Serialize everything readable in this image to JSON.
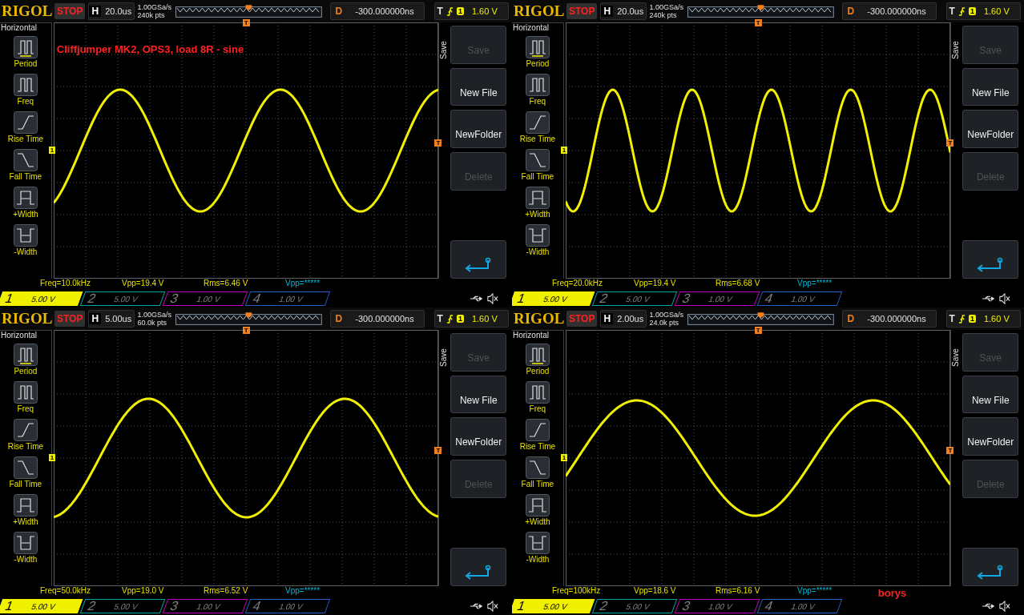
{
  "panels": [
    {
      "logo": "RIGOL",
      "status": "STOP",
      "h_label": "H",
      "timebase": "20.0us",
      "sample_rate": "1.00GSa/s",
      "points": "240k pts",
      "d_label": "D",
      "delay": "-300.000000ns",
      "t_label": "T",
      "trigger_source": "1",
      "trigger_level": "1.60 V",
      "annotation": {
        "text": "Cliffjumper MK2, OPS3, load 8R - sine",
        "kind": "top"
      },
      "trigger_marker": "T",
      "trigger_level_marker": "T",
      "channel_marker": "1",
      "side_title": "Horizontal",
      "sidebar": [
        {
          "label": "Period",
          "kind": "period"
        },
        {
          "label": "Freq",
          "kind": "freq"
        },
        {
          "label": "Rise Time",
          "kind": "rise"
        },
        {
          "label": "Fall Time",
          "kind": "fall"
        },
        {
          "label": "+Width",
          "kind": "pwidth"
        },
        {
          "label": "-Width",
          "kind": "nwidth"
        }
      ],
      "menu_title": "Save",
      "menu": [
        {
          "label": "Save",
          "disabled": true
        },
        {
          "label": "New File",
          "disabled": false
        },
        {
          "label": "NewFolder",
          "disabled": false
        },
        {
          "label": "Delete",
          "disabled": true
        }
      ],
      "measurements": [
        {
          "text": "Freq=10.0kHz",
          "color": "#e8e000"
        },
        {
          "text": "Vpp=19.4 V",
          "color": "#e8e000"
        },
        {
          "text": "Rms=6.46 V",
          "color": "#e8e000"
        },
        {
          "text": "Vpp=*****",
          "color": "#00b8d8"
        }
      ],
      "channels": [
        {
          "number": "1",
          "scale": "5.00 V",
          "selected": true,
          "color": "#f0f000"
        },
        {
          "number": "2",
          "scale": "5.00 V",
          "selected": false,
          "color": "#00a8a0"
        },
        {
          "number": "3",
          "scale": "1.00 V",
          "selected": false,
          "color": "#c000c0"
        },
        {
          "number": "4",
          "scale": "1.00 V",
          "selected": false,
          "color": "#2060c0"
        }
      ]
    },
    {
      "logo": "RIGOL",
      "status": "STOP",
      "h_label": "H",
      "timebase": "20.0us",
      "sample_rate": "1.00GSa/s",
      "points": "240k pts",
      "d_label": "D",
      "delay": "-300.000000ns",
      "t_label": "T",
      "trigger_source": "1",
      "trigger_level": "1.60 V",
      "trigger_marker": "T",
      "trigger_level_marker": "T",
      "channel_marker": "1",
      "side_title": "Horizontal",
      "sidebar": [
        {
          "label": "Period",
          "kind": "period"
        },
        {
          "label": "Freq",
          "kind": "freq"
        },
        {
          "label": "Rise Time",
          "kind": "rise"
        },
        {
          "label": "Fall Time",
          "kind": "fall"
        },
        {
          "label": "+Width",
          "kind": "pwidth"
        },
        {
          "label": "-Width",
          "kind": "nwidth"
        }
      ],
      "menu_title": "Save",
      "menu": [
        {
          "label": "Save",
          "disabled": true
        },
        {
          "label": "New File",
          "disabled": false
        },
        {
          "label": "NewFolder",
          "disabled": false
        },
        {
          "label": "Delete",
          "disabled": true
        }
      ],
      "measurements": [
        {
          "text": "Freq=20.0kHz",
          "color": "#e8e000"
        },
        {
          "text": "Vpp=19.4 V",
          "color": "#e8e000"
        },
        {
          "text": "Rms=6.68 V",
          "color": "#e8e000"
        },
        {
          "text": "Vpp=*****",
          "color": "#00b8d8"
        }
      ],
      "channels": [
        {
          "number": "1",
          "scale": "5.00 V",
          "selected": true,
          "color": "#f0f000"
        },
        {
          "number": "2",
          "scale": "5.00 V",
          "selected": false,
          "color": "#00a8a0"
        },
        {
          "number": "3",
          "scale": "1.00 V",
          "selected": false,
          "color": "#c000c0"
        },
        {
          "number": "4",
          "scale": "1.00 V",
          "selected": false,
          "color": "#2060c0"
        }
      ]
    },
    {
      "logo": "RIGOL",
      "status": "STOP",
      "h_label": "H",
      "timebase": "5.00us",
      "sample_rate": "1.00GSa/s",
      "points": "60.0k pts",
      "d_label": "D",
      "delay": "-300.000000ns",
      "t_label": "T",
      "trigger_source": "1",
      "trigger_level": "1.60 V",
      "trigger_marker": "T",
      "trigger_level_marker": "T",
      "channel_marker": "1",
      "side_title": "Horizontal",
      "sidebar": [
        {
          "label": "Period",
          "kind": "period"
        },
        {
          "label": "Freq",
          "kind": "freq"
        },
        {
          "label": "Rise Time",
          "kind": "rise"
        },
        {
          "label": "Fall Time",
          "kind": "fall"
        },
        {
          "label": "+Width",
          "kind": "pwidth"
        },
        {
          "label": "-Width",
          "kind": "nwidth"
        }
      ],
      "menu_title": "Save",
      "menu": [
        {
          "label": "Save",
          "disabled": true
        },
        {
          "label": "New File",
          "disabled": false
        },
        {
          "label": "NewFolder",
          "disabled": false
        },
        {
          "label": "Delete",
          "disabled": true
        }
      ],
      "measurements": [
        {
          "text": "Freq=50.0kHz",
          "color": "#e8e000"
        },
        {
          "text": "Vpp=19.0 V",
          "color": "#e8e000"
        },
        {
          "text": "Rms=6.52 V",
          "color": "#e8e000"
        },
        {
          "text": "Vpp=*****",
          "color": "#00b8d8"
        }
      ],
      "channels": [
        {
          "number": "1",
          "scale": "5.00 V",
          "selected": true,
          "color": "#f0f000"
        },
        {
          "number": "2",
          "scale": "5.00 V",
          "selected": false,
          "color": "#00a8a0"
        },
        {
          "number": "3",
          "scale": "1.00 V",
          "selected": false,
          "color": "#c000c0"
        },
        {
          "number": "4",
          "scale": "1.00 V",
          "selected": false,
          "color": "#2060c0"
        }
      ]
    },
    {
      "logo": "RIGOL",
      "status": "STOP",
      "h_label": "H",
      "timebase": "2.00us",
      "sample_rate": "1.00GSa/s",
      "points": "24.0k pts",
      "d_label": "D",
      "delay": "-300.000000ns",
      "t_label": "T",
      "trigger_source": "1",
      "trigger_level": "1.60 V",
      "annotation": {
        "text": "borys",
        "kind": "bottom"
      },
      "trigger_marker": "T",
      "trigger_level_marker": "T",
      "channel_marker": "1",
      "side_title": "Horizontal",
      "sidebar": [
        {
          "label": "Period",
          "kind": "period"
        },
        {
          "label": "Freq",
          "kind": "freq"
        },
        {
          "label": "Rise Time",
          "kind": "rise"
        },
        {
          "label": "Fall Time",
          "kind": "fall"
        },
        {
          "label": "+Width",
          "kind": "pwidth"
        },
        {
          "label": "-Width",
          "kind": "nwidth"
        }
      ],
      "menu_title": "Save",
      "menu": [
        {
          "label": "Save",
          "disabled": true
        },
        {
          "label": "New File",
          "disabled": false
        },
        {
          "label": "NewFolder",
          "disabled": false
        },
        {
          "label": "Delete",
          "disabled": true
        }
      ],
      "measurements": [
        {
          "text": "Freq=100kHz",
          "color": "#e8e000"
        },
        {
          "text": "Vpp=18.6 V",
          "color": "#e8e000"
        },
        {
          "text": "Rms=6.16 V",
          "color": "#e8e000"
        },
        {
          "text": "Vpp=*****",
          "color": "#00b8d8"
        }
      ],
      "channels": [
        {
          "number": "1",
          "scale": "5.00 V",
          "selected": true,
          "color": "#f0f000"
        },
        {
          "number": "2",
          "scale": "5.00 V",
          "selected": false,
          "color": "#00a8a0"
        },
        {
          "number": "3",
          "scale": "1.00 V",
          "selected": false,
          "color": "#c000c0"
        },
        {
          "number": "4",
          "scale": "1.00 V",
          "selected": false,
          "color": "#2060c0"
        }
      ]
    }
  ]
}
